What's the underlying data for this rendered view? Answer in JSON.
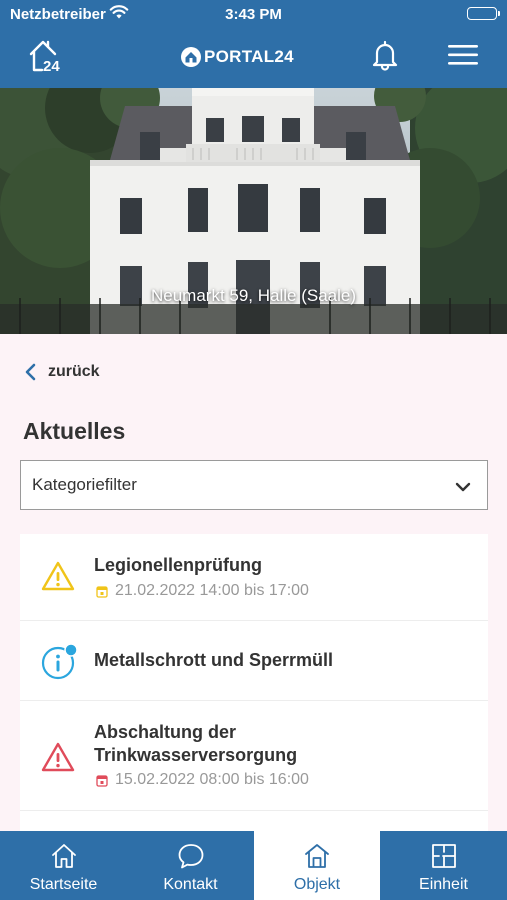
{
  "status_bar": {
    "carrier": "Netzbetreiber",
    "time": "3:43 PM"
  },
  "header": {
    "logo_text": "PORTAL24",
    "home_badge": "24"
  },
  "hero": {
    "address": "Neumarkt 59, Halle (Saale)"
  },
  "back": {
    "label": "zurück"
  },
  "section": {
    "title": "Aktuelles"
  },
  "filter": {
    "label": "Kategoriefilter"
  },
  "news": [
    {
      "title": "Legionellenprüfung",
      "date": "21.02.2022 14:00 bis 17:00",
      "icon": "warning-yellow-icon",
      "color": "#f0c419"
    },
    {
      "title": "Metallschrott und Sperrmüll",
      "date": "",
      "icon": "info-icon",
      "color": "#2ba6de"
    },
    {
      "title": "Abschaltung der Trinkwasserversorgung",
      "date": "15.02.2022 08:00 bis 16:00",
      "icon": "warning-red-icon",
      "color": "#e04b5a"
    }
  ],
  "tabs": [
    {
      "label": "Startseite",
      "icon": "home-icon"
    },
    {
      "label": "Kontakt",
      "icon": "chat-icon"
    },
    {
      "label": "Objekt",
      "icon": "building-icon",
      "active": true
    },
    {
      "label": "Einheit",
      "icon": "floorplan-icon"
    }
  ],
  "colors": {
    "primary": "#2e6fa8",
    "background": "#fdf3f7"
  }
}
